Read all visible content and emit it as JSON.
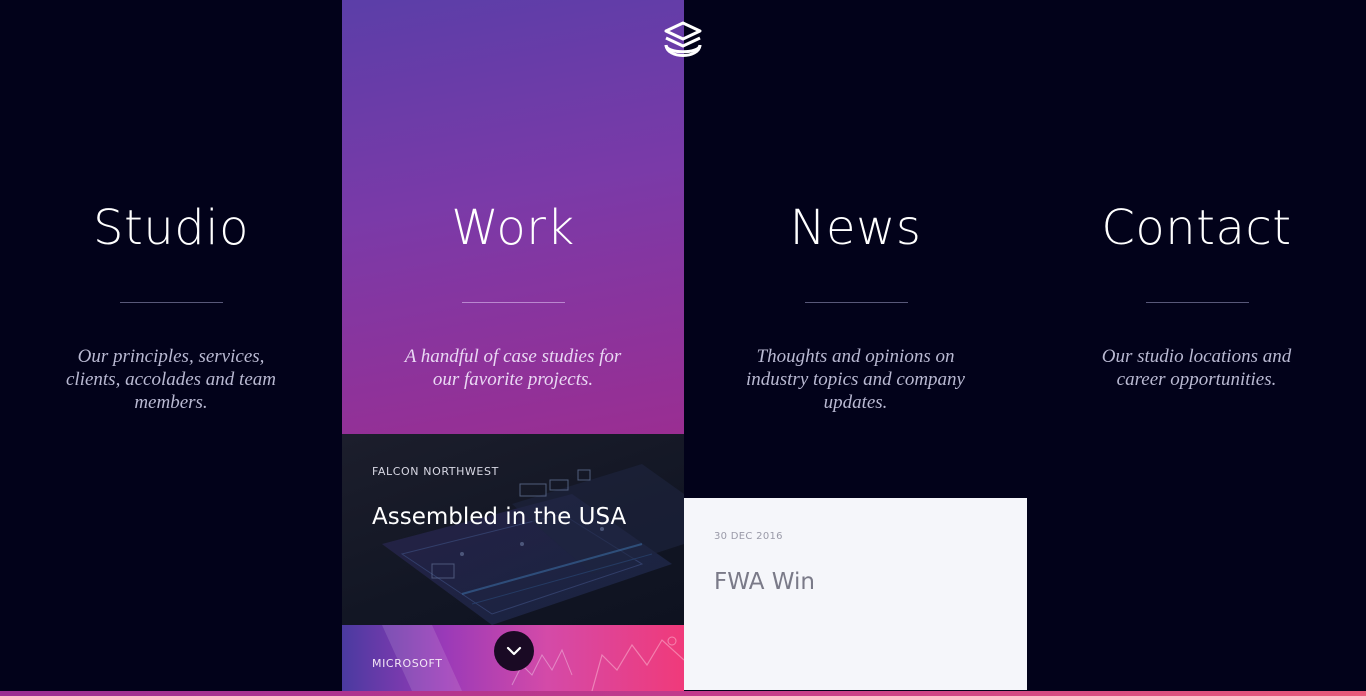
{
  "nav": [
    {
      "title": "Studio",
      "description": "Our principles, services, clients, accolades and team members."
    },
    {
      "title": "Work",
      "description": "A handful of case studies for our favorite projects."
    },
    {
      "title": "News",
      "description": "Thoughts and opinions on industry topics and company updates."
    },
    {
      "title": "Contact",
      "description": "Our studio locations and career opportunities."
    }
  ],
  "work_cases": [
    {
      "client": "FALCON NORTHWEST",
      "title": "Assembled in the USA"
    },
    {
      "client": "MICROSOFT"
    }
  ],
  "news_card": {
    "date": "30 DEC 2016",
    "title": "FWA Win"
  },
  "logo": {
    "icon": "layers-icon"
  },
  "scroll_button": {
    "icon": "chevron-down-icon"
  },
  "colors": {
    "background": "#02021a",
    "work_gradient_top": "#5b3ea8",
    "work_gradient_bottom": "#9a2e92",
    "accent_pink": "#f03a7a",
    "news_card_bg": "#f5f6fa"
  }
}
